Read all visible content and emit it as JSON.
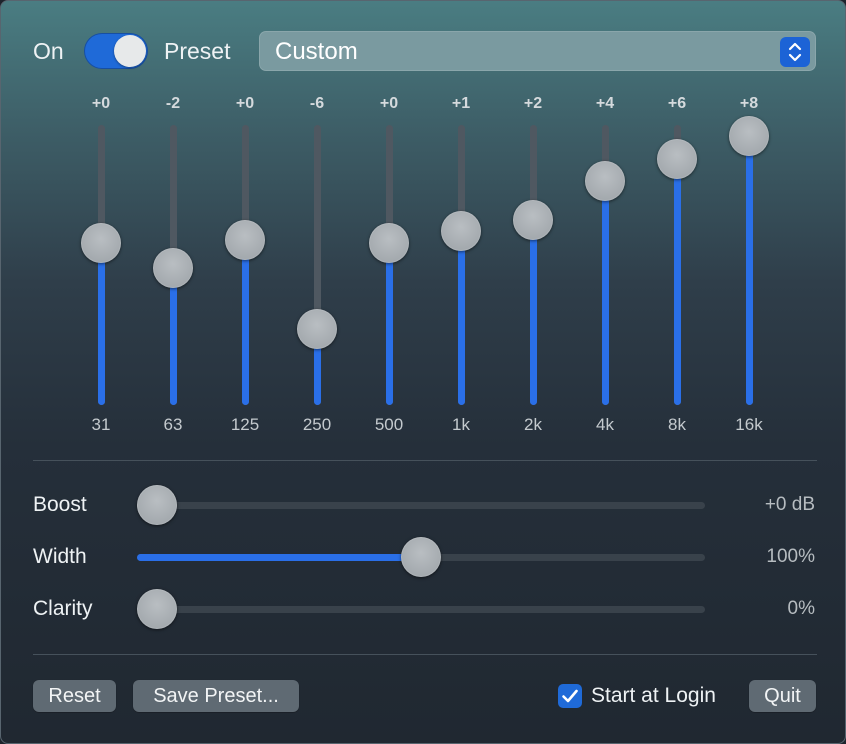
{
  "header": {
    "power_label": "On",
    "power_on": true,
    "preset_label": "Preset",
    "preset_value": "Custom"
  },
  "equalizer": {
    "bands": [
      {
        "freq": "31",
        "gain": "+0",
        "level": 0.58
      },
      {
        "freq": "63",
        "gain": "-2",
        "level": 0.49
      },
      {
        "freq": "125",
        "gain": "+0",
        "level": 0.59
      },
      {
        "freq": "250",
        "gain": "-6",
        "level": 0.27
      },
      {
        "freq": "500",
        "gain": "+0",
        "level": 0.58
      },
      {
        "freq": "1k",
        "gain": "+1",
        "level": 0.62
      },
      {
        "freq": "2k",
        "gain": "+2",
        "level": 0.66
      },
      {
        "freq": "4k",
        "gain": "+4",
        "level": 0.8
      },
      {
        "freq": "8k",
        "gain": "+6",
        "level": 0.88
      },
      {
        "freq": "16k",
        "gain": "+8",
        "level": 0.96
      }
    ]
  },
  "sliders": [
    {
      "id": "boost",
      "label": "Boost",
      "value": "+0 dB",
      "level": 0.0
    },
    {
      "id": "width",
      "label": "Width",
      "value": "100%",
      "level": 0.5
    },
    {
      "id": "clarity",
      "label": "Clarity",
      "value": "0%",
      "level": 0.0
    }
  ],
  "footer": {
    "reset_label": "Reset",
    "save_preset_label": "Save Preset...",
    "start_at_login_label": "Start at Login",
    "start_at_login_checked": true,
    "quit_label": "Quit"
  },
  "colors": {
    "accent": "#2a6fe8",
    "knob": "#a7acb0"
  },
  "icons": {
    "preset_stepper": "chevron-up-down-icon",
    "checkbox": "checkmark-icon"
  }
}
